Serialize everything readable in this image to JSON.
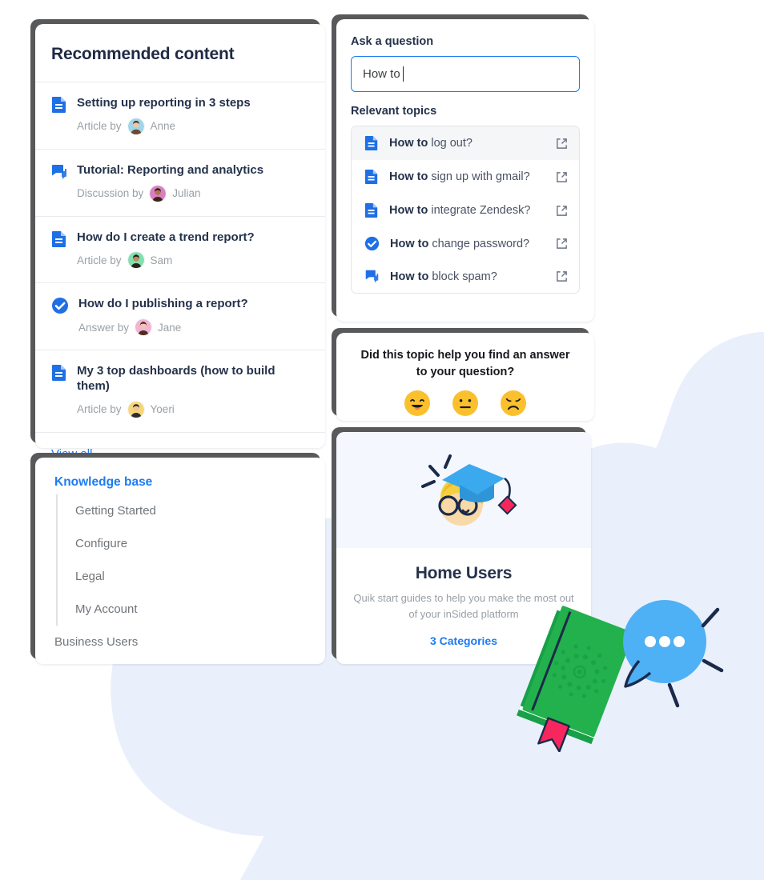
{
  "recommended": {
    "heading": "Recommended content",
    "items": [
      {
        "icon": "document-icon",
        "title": "Setting up reporting in 3 steps",
        "meta_prefix": "Article by",
        "author": "Anne",
        "avatar_color": "#9fd6e8"
      },
      {
        "icon": "discussion-icon",
        "title": "Tutorial: Reporting and analytics",
        "meta_prefix": "Discussion by",
        "author": "Julian",
        "avatar_color": "#d87fc2"
      },
      {
        "icon": "document-icon",
        "title": "How do I create a trend report?",
        "meta_prefix": "Article by",
        "author": "Sam",
        "avatar_color": "#7fe0b0"
      },
      {
        "icon": "answer-check-icon",
        "title": "How do I publishing a report?",
        "meta_prefix": "Answer by",
        "author": "Jane",
        "avatar_color": "#f3b4d4"
      },
      {
        "icon": "document-icon",
        "title": "My 3 top dashboards (how to build them)",
        "meta_prefix": "Article by",
        "author": "Yoeri",
        "avatar_color": "#f5d778"
      }
    ],
    "view_all_label": "View all"
  },
  "knowledge_base": {
    "title": "Knowledge base",
    "sub_items": [
      "Getting Started",
      "Configure",
      "Legal",
      "My Account"
    ],
    "root_item": "Business Users"
  },
  "ask": {
    "label": "Ask a question",
    "input_value": "How to",
    "input_placeholder": "Ask a question",
    "topics_label": "Relevant topics",
    "topics": [
      {
        "icon": "document-icon",
        "bold": "How to",
        "rest": " log out?",
        "link_icon": "external-link-icon",
        "active": true
      },
      {
        "icon": "document-icon",
        "bold": "How to",
        "rest": " sign up with gmail?",
        "link_icon": "external-link-icon",
        "active": false
      },
      {
        "icon": "document-icon",
        "bold": "How to",
        "rest": " integrate Zendesk?",
        "link_icon": "external-link-icon",
        "active": false
      },
      {
        "icon": "answer-check-icon",
        "bold": "How to",
        "rest": " change password?",
        "link_icon": "external-link-icon",
        "active": false
      },
      {
        "icon": "discussion-icon",
        "bold": "How to",
        "rest": " block spam?",
        "link_icon": "external-link-icon",
        "active": false
      }
    ]
  },
  "feedback": {
    "question": "Did this topic help you find an answer to your question?",
    "faces": [
      "happy-face-icon",
      "neutral-face-icon",
      "sad-face-icon"
    ]
  },
  "home_users": {
    "illustration": "graduate-face-illustration",
    "title": "Home Users",
    "description": "Quik start guides to help you make the most out of your inSided platform",
    "categories_label": "3 Categories"
  },
  "decoration": {
    "book": "green-book-illustration",
    "bubble": "chat-bubble-illustration",
    "blob": "background-blob"
  },
  "colors": {
    "accent_blue": "#1e7bf0",
    "icon_blue": "#1f6fe5",
    "text_dark": "#25324b",
    "text_muted": "#9aa0a6",
    "blob": "#e9effb",
    "bubble_blue": "#4eb0f5",
    "book_green": "#22b14c",
    "bookmark_red": "#f7275e",
    "emoji_yellow": "#fbc02d"
  }
}
